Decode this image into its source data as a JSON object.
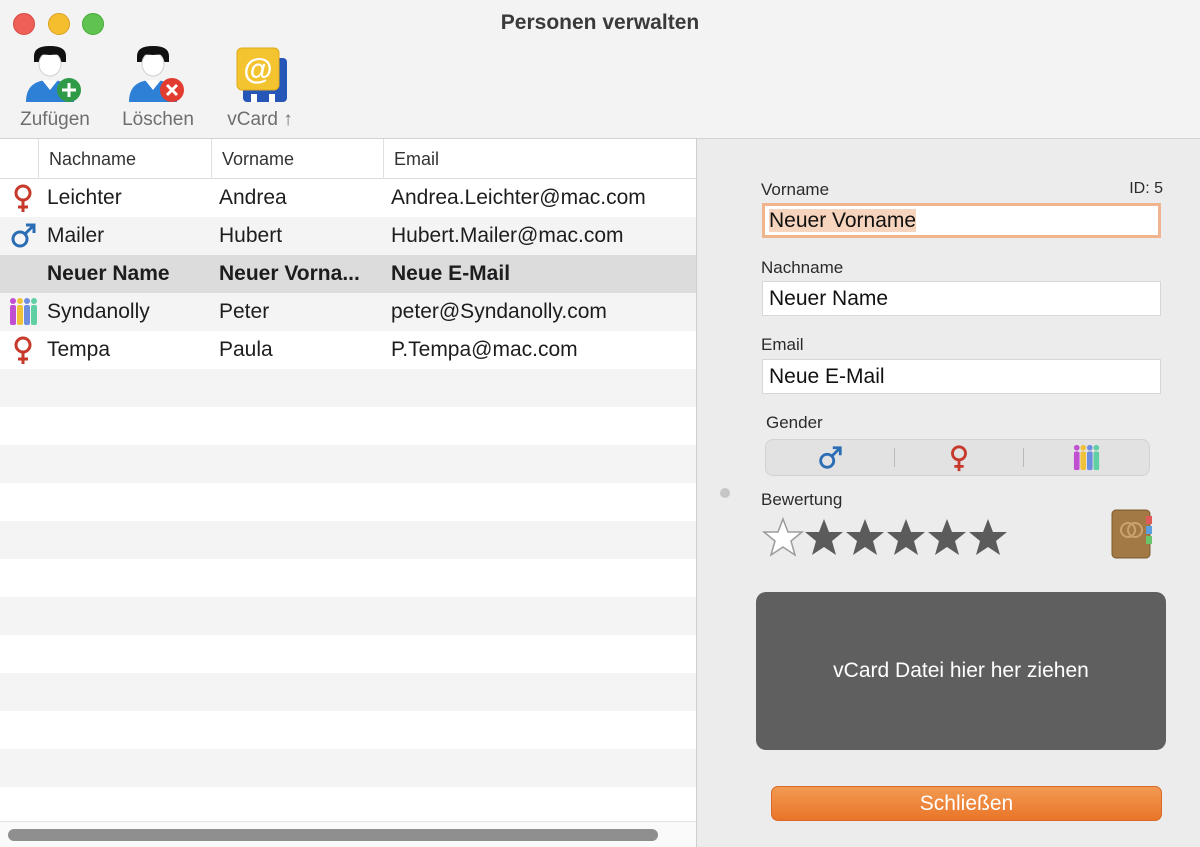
{
  "window": {
    "title": "Personen verwalten"
  },
  "toolbar": {
    "add_label": "Zufügen",
    "delete_label": "Löschen",
    "vcard_label": "vCard ↑"
  },
  "table": {
    "columns": [
      "Nachname",
      "Vorname",
      "Email"
    ],
    "rows": [
      {
        "gender": "female",
        "lastname": "Leichter",
        "firstname": "Andrea",
        "email": "Andrea.Leichter@mac.com"
      },
      {
        "gender": "male",
        "lastname": "Mailer",
        "firstname": "Hubert",
        "email": "Hubert.Mailer@mac.com"
      },
      {
        "gender": "none",
        "lastname": "Neuer Name",
        "firstname": "Neuer Vorna...",
        "email": "Neue E-Mail",
        "selected": true
      },
      {
        "gender": "diverse",
        "lastname": "Syndanolly",
        "firstname": "Peter",
        "email": "peter@Syndanolly.com"
      },
      {
        "gender": "female",
        "lastname": "Tempa",
        "firstname": "Paula",
        "email": "P.Tempa@mac.com"
      }
    ]
  },
  "detail": {
    "firstname_label": "Vorname",
    "id_label": "ID: 5",
    "firstname_value": "Neuer Vorname",
    "lastname_label": "Nachname",
    "lastname_value": "Neuer Name",
    "email_label": "Email",
    "email_value": "Neue E-Mail",
    "gender_label": "Gender",
    "gender_options": [
      "male-icon",
      "female-icon",
      "diverse-icon"
    ],
    "rating_label": "Bewertung",
    "rating_max": 6,
    "rating_filled": 5,
    "dropzone_text": "vCard Datei hier her ziehen",
    "close_label": "Schließen"
  },
  "colors": {
    "male": "#2a6db5",
    "female": "#c6392b",
    "accent_orange": "#ee8236",
    "dropzone": "#5f5f5f",
    "star": "#5b5b5b"
  }
}
